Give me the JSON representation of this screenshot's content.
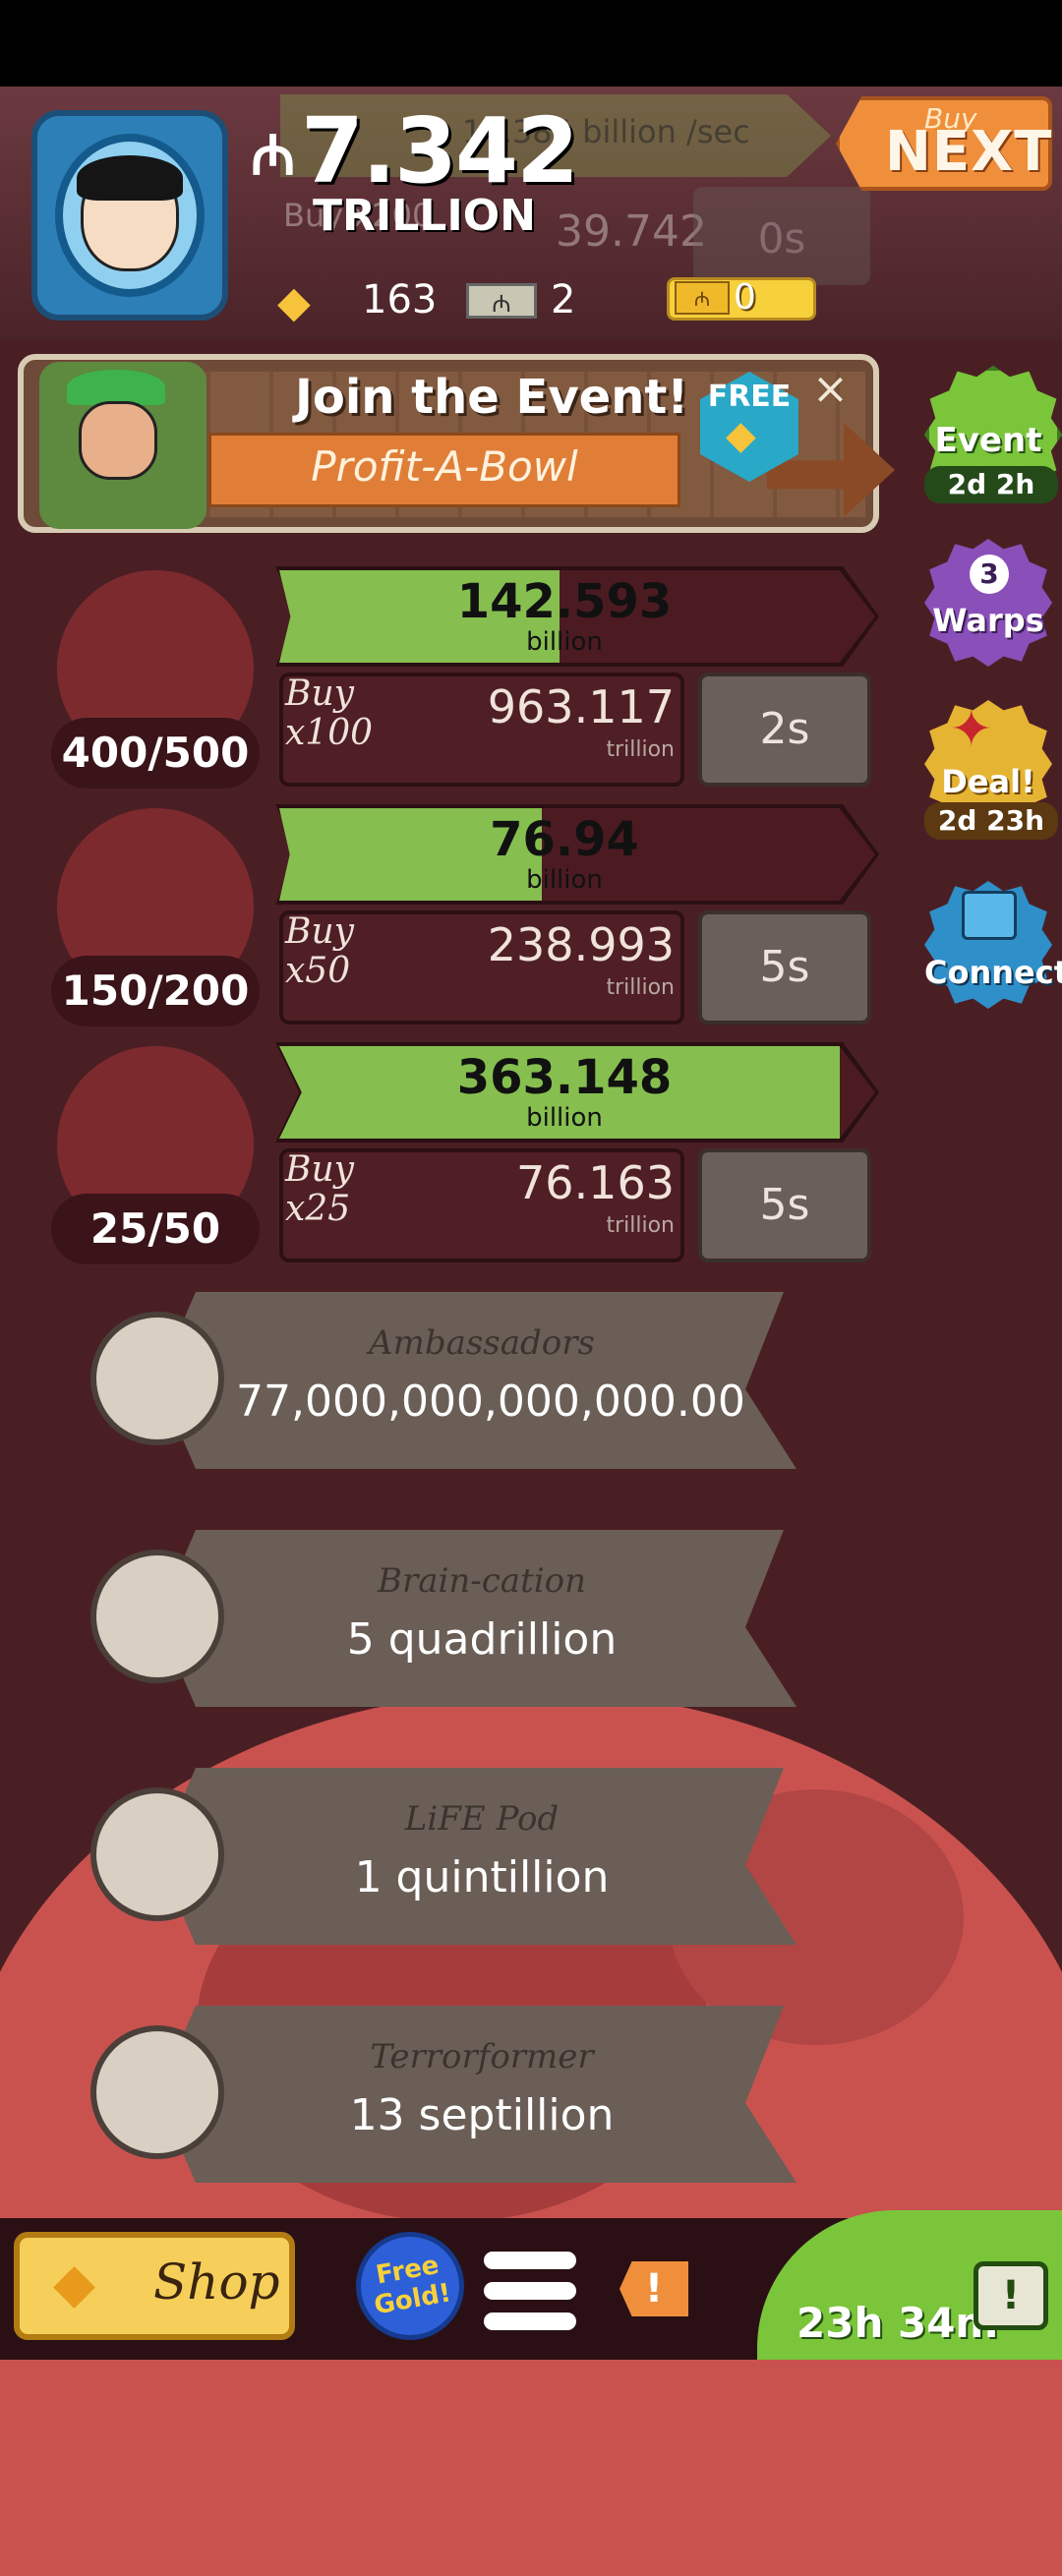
{
  "header": {
    "money_symbol": "₼",
    "money_value": "7.342",
    "money_unit": "TRILLION",
    "top_progress_text": "17.385 billion /sec",
    "ghost_buy": "Buy x200",
    "ghost_price": "39.742",
    "ghost_time": "0s",
    "gold_count": "163",
    "megabucks_symbol": "₼",
    "megabucks_count": "2",
    "ticket_symbol": "₼",
    "ticket_count": "0",
    "buy_next_small": "Buy",
    "buy_next_big": "NEXT"
  },
  "event_banner": {
    "title": "Join the Event!",
    "subtitle": "Profit-A-Bowl",
    "free_label": "FREE",
    "close": "×"
  },
  "side_buttons": {
    "event_label": "Event",
    "event_timer": "2d 2h",
    "warps_count": "3",
    "warps_label": "Warps",
    "deal_label": "Deal!",
    "deal_timer": "2d 23h",
    "connect_label": "Connect"
  },
  "businesses": [
    {
      "count": "400/500",
      "revenue": "142.593",
      "revenue_unit": "billion",
      "progress": 0.47,
      "buy_label": "Buy x100",
      "price": "963.117",
      "price_unit": "trillion",
      "time": "2s"
    },
    {
      "count": "150/200",
      "revenue": "76.94",
      "revenue_unit": "billion",
      "progress": 0.44,
      "buy_label": "Buy x50",
      "price": "238.993",
      "price_unit": "trillion",
      "time": "5s"
    },
    {
      "count": "25/50",
      "revenue": "363.148",
      "revenue_unit": "billion",
      "progress": 0.94,
      "buy_label": "Buy x25",
      "price": "76.163",
      "price_unit": "trillion",
      "time": "5s"
    }
  ],
  "managers": [
    {
      "title": "Ambassadors",
      "value": "77,000,000,000,000.00"
    },
    {
      "title": "Brain-cation",
      "value": "5 quadrillion"
    },
    {
      "title": "LiFE Pod",
      "value": "1 quintillion"
    },
    {
      "title": "Terrorformer",
      "value": "13 septillion"
    }
  ],
  "bottom_bar": {
    "shop_label": "Shop",
    "free_gold_label": "Free Gold!",
    "alert_label": "!",
    "timer": "23h 34m",
    "tv_label": "!"
  },
  "colors": {
    "progress_green": "#86bf4f",
    "background": "#4a1f24",
    "accent_orange": "#ef8f3b"
  },
  "icons": {
    "gold": "gold-bar-icon",
    "megabucks": "megabucks-icon",
    "ticket": "ticket-icon",
    "menu": "hamburger-menu-icon",
    "alert": "alert-icon",
    "tv": "tv-icon"
  }
}
